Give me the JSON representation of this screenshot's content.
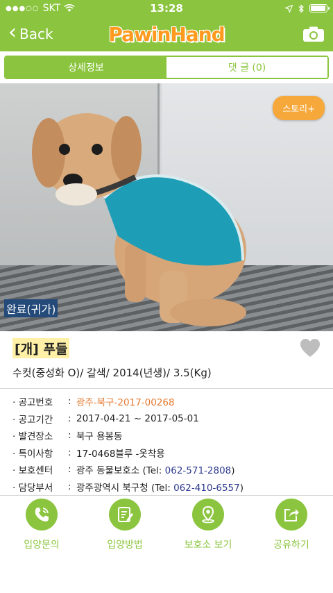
{
  "status_bar": {
    "carrier": "SKT",
    "signal_dots": "●●●○○",
    "time": "13:28",
    "battery_level": 0.95
  },
  "nav": {
    "back_label": "Back",
    "logo_text": "PawinHand",
    "icons": {
      "back": "chevron-left-icon",
      "camera": "camera-icon"
    }
  },
  "tabs": [
    {
      "label": "상세정보",
      "active": true
    },
    {
      "label": "댓 글 (0)",
      "active": false
    }
  ],
  "photo": {
    "story_label": "스토리+",
    "status_label": "완료(귀가)"
  },
  "animal": {
    "title": "[개] 푸들",
    "subtitle": "수컷(중성화 O)/ 갈색/ 2014(년생)/ 3.5(Kg)"
  },
  "details": [
    {
      "bullet": "·",
      "label": "공고번호",
      "sep": ":",
      "value": "광주-북구-2017-00268"
    },
    {
      "bullet": "·",
      "label": "공고기간",
      "sep": ":",
      "value": "2017-04-21 ~ 2017-05-01"
    },
    {
      "bullet": "·",
      "label": "발견장소",
      "sep": ":",
      "value": "북구 용봉동"
    },
    {
      "bullet": "·",
      "label": "특이사항",
      "sep": ":",
      "value": "17-0468블루 -옷착용"
    },
    {
      "bullet": "·",
      "label": "보호센터",
      "sep": ":",
      "value": "광주 동물보호소 (Tel: ",
      "tel": "062-571-2808",
      "close": ")"
    },
    {
      "bullet": "·",
      "label": "담당부서",
      "sep": ":",
      "value": "광주광역시 북구청 (Tel: ",
      "tel": "062-410-6557",
      "close": ")"
    }
  ],
  "actions": [
    {
      "label": "입양문의",
      "icon": "phone-icon"
    },
    {
      "label": "입양방법",
      "icon": "notepad-icon"
    },
    {
      "label": "보호소 보기",
      "icon": "map-pin-icon"
    },
    {
      "label": "공유하기",
      "icon": "share-icon"
    }
  ],
  "colors": {
    "brand_green": "#8bc53f",
    "logo_orange": "#ff9a1f",
    "story_orange": "#f7a83b",
    "highlight_orange": "#e4792f",
    "tel_blue": "#2e3b8f",
    "status_label_bg": "#244a7a"
  }
}
